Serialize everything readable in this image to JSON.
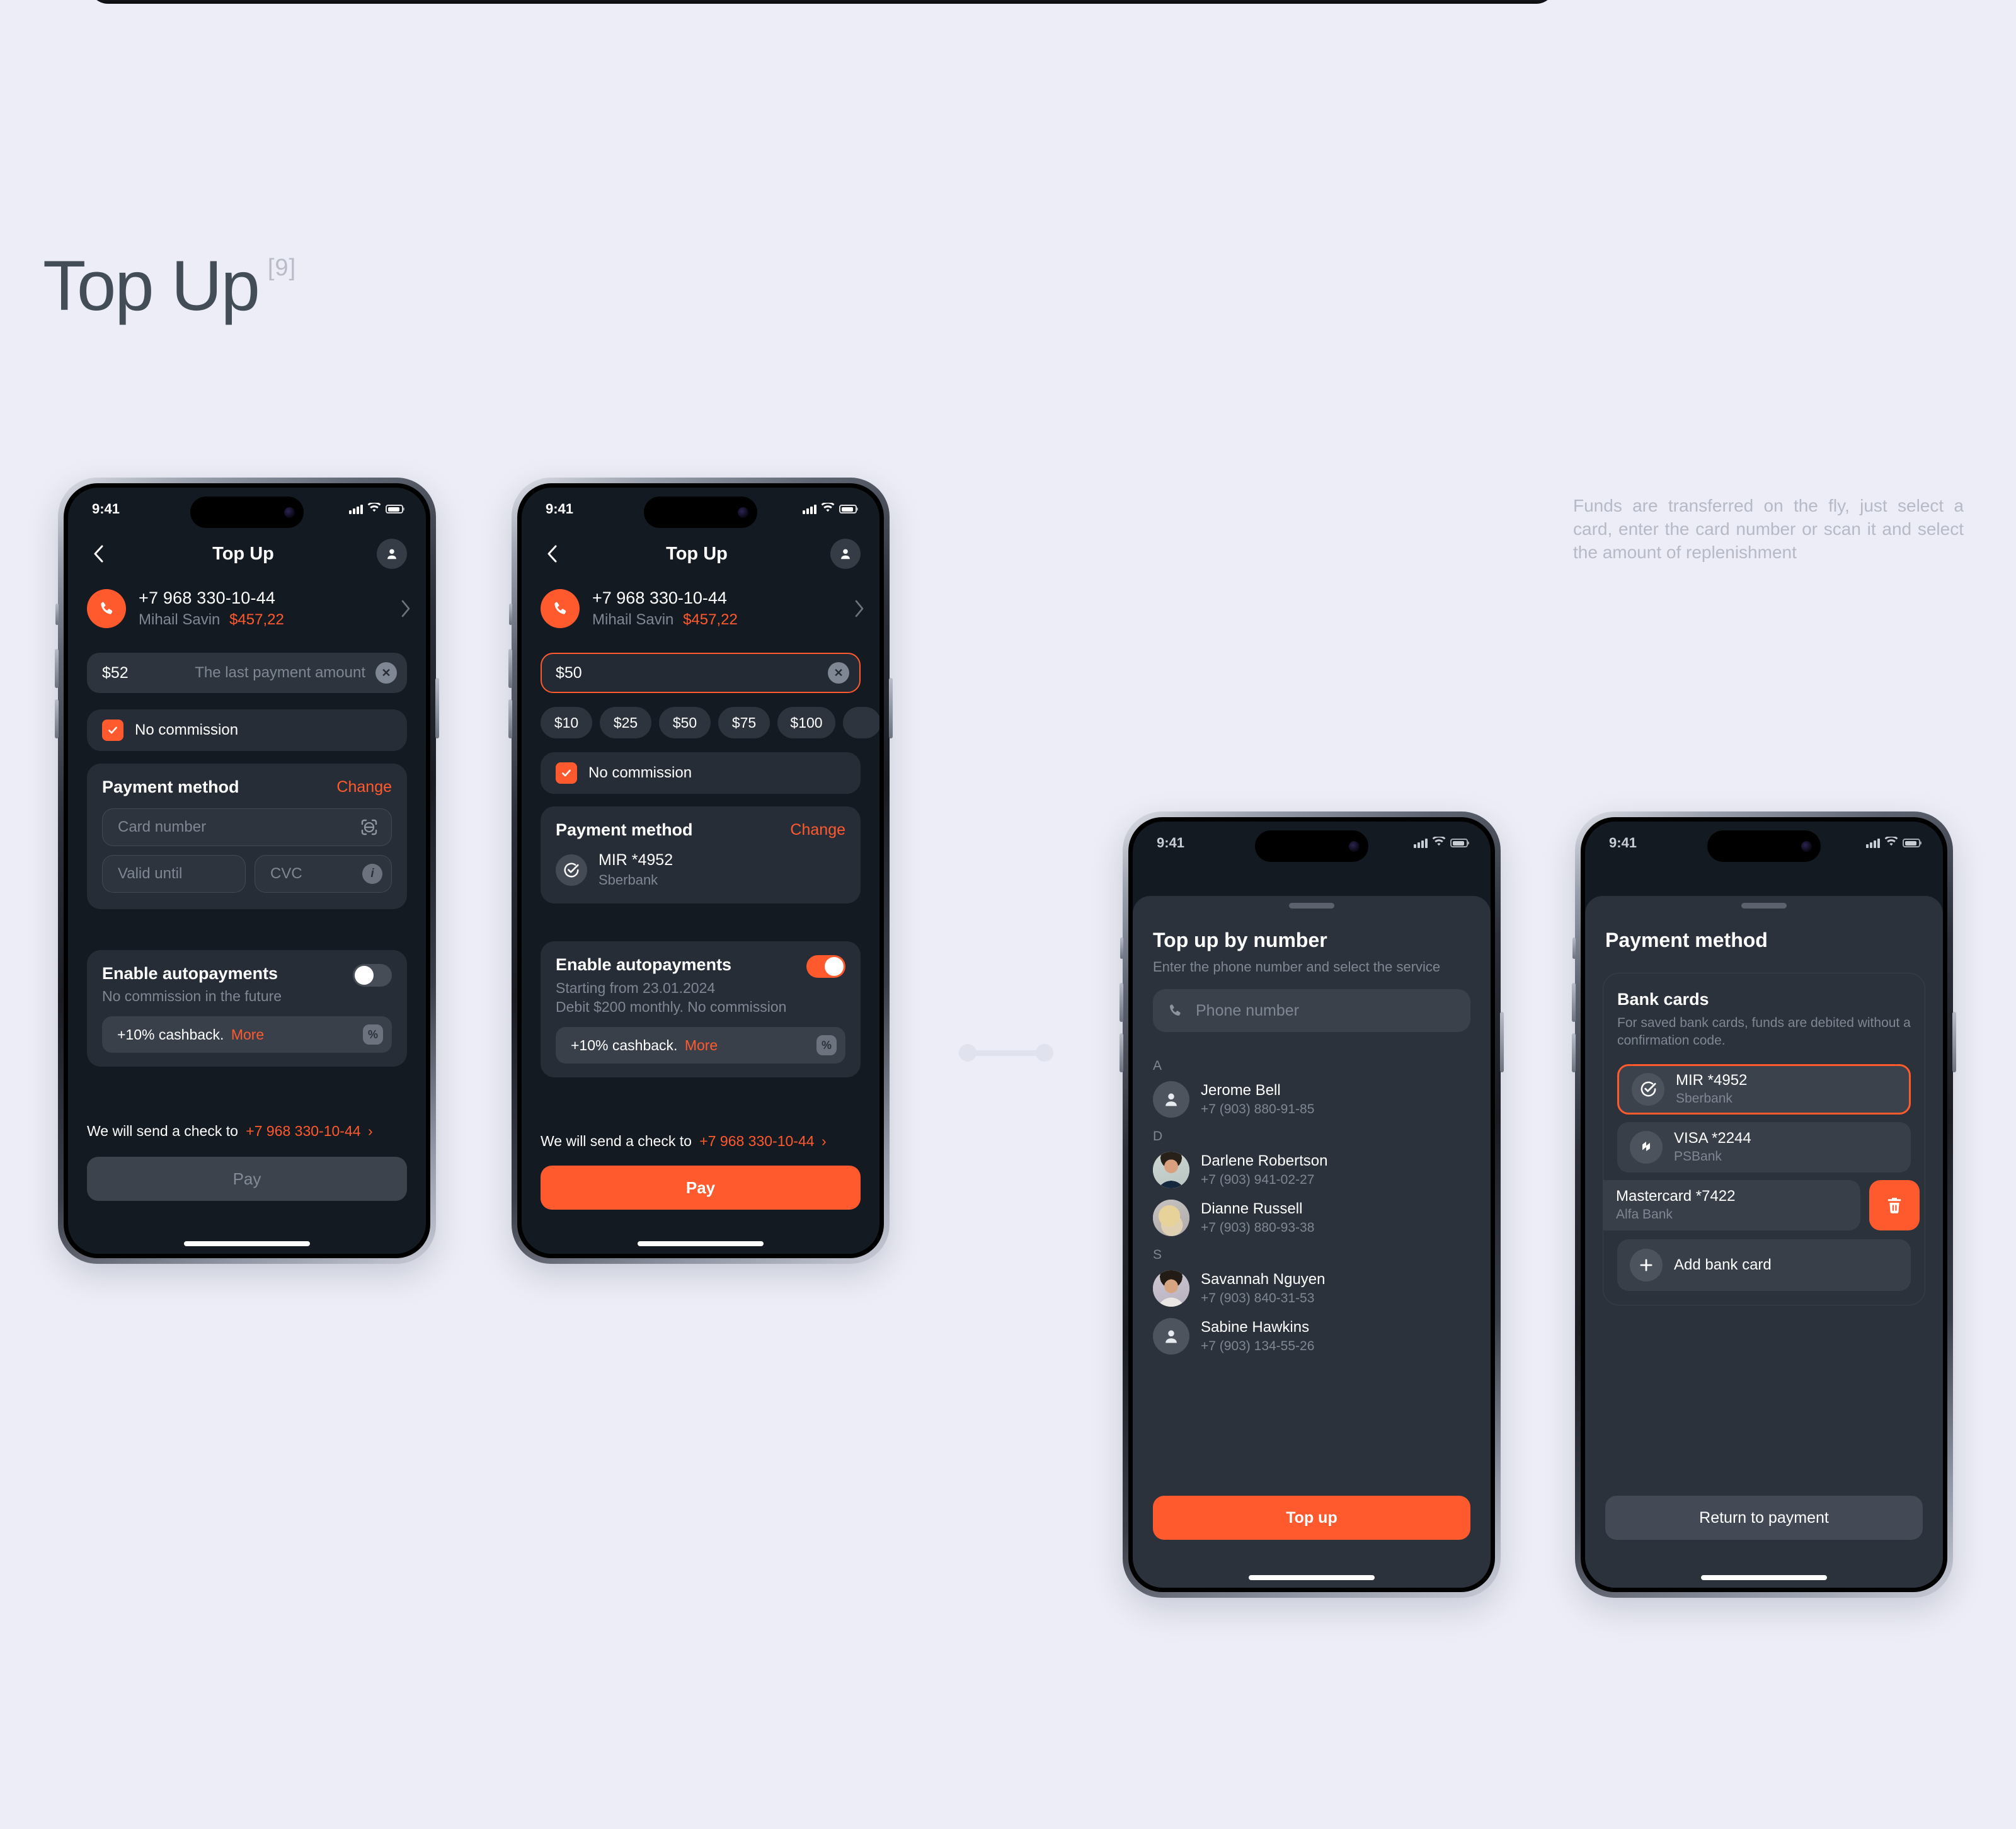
{
  "page": {
    "title": "Top Up",
    "badge": "[9]",
    "note": "Funds are transferred on the fly, just select a card, enter the card number or scan it and select the amount of replenishment"
  },
  "status_bar": {
    "time": "9:41"
  },
  "screen1": {
    "nav": {
      "back_icon": "chevron-left-icon",
      "title": "Top Up",
      "profile_icon": "person-icon"
    },
    "account": {
      "icon": "phone-icon",
      "phone": "+7 968 330-10-44",
      "name": "Mihail Savin",
      "balance": "$457,22",
      "chevron": "chevron-right-icon"
    },
    "amount_field": {
      "value": "$52",
      "hint": "The last payment amount",
      "clear_icon": "close-circle-icon"
    },
    "commission": {
      "label": "No commission",
      "checked": true
    },
    "payment_method": {
      "title": "Payment method",
      "change_label": "Change",
      "card_number_placeholder": "Card number",
      "scan_icon": "scan-card-icon",
      "valid_until_placeholder": "Valid until",
      "cvc_placeholder": "CVC",
      "info_icon": "info-icon"
    },
    "autopay": {
      "title": "Enable autopayments",
      "subtitle": "No commission in the future",
      "enabled": false,
      "cashback_text": "+10% cashback.",
      "cashback_link": "More",
      "percent_icon": "percent-icon"
    },
    "check_note": {
      "prefix": "We will send a check to",
      "phone": "+7 968 330-10-44",
      "chevron": "chevron-right-icon"
    },
    "pay_button": {
      "label": "Pay",
      "enabled": false
    }
  },
  "screen2": {
    "nav": {
      "back_icon": "chevron-left-icon",
      "title": "Top Up",
      "profile_icon": "person-icon"
    },
    "account": {
      "icon": "phone-icon",
      "phone": "+7 968 330-10-44",
      "name": "Mihail Savin",
      "balance": "$457,22",
      "chevron": "chevron-right-icon"
    },
    "amount_field": {
      "value": "$50",
      "clear_icon": "close-circle-icon",
      "focused": true
    },
    "quick_amounts": [
      "$10",
      "$25",
      "$50",
      "$75",
      "$100"
    ],
    "commission": {
      "label": "No commission",
      "checked": true
    },
    "payment_method": {
      "title": "Payment method",
      "change_label": "Change",
      "card_icon": "mir-check-icon",
      "card_name": "MIR *4952",
      "card_bank": "Sberbank"
    },
    "autopay": {
      "title": "Enable autopayments",
      "line1": "Starting from 23.01.2024",
      "line2": "Debit $200 monthly. No commission",
      "enabled": true,
      "cashback_text": "+10% cashback.",
      "cashback_link": "More",
      "percent_icon": "percent-icon"
    },
    "check_note": {
      "prefix": "We will send a check to",
      "phone": "+7 968 330-10-44",
      "chevron": "chevron-right-icon"
    },
    "pay_button": {
      "label": "Pay",
      "enabled": true
    }
  },
  "screen3": {
    "title": "Top up by number",
    "subtitle": "Enter the phone number and select the service",
    "search": {
      "icon": "phone-icon",
      "placeholder": "Phone number",
      "value": ""
    },
    "sections": [
      {
        "letter": "A",
        "contacts": [
          {
            "name": "Jerome Bell",
            "phone": "+7 (903) 880-91-85",
            "avatar": "person-placeholder"
          }
        ]
      },
      {
        "letter": "D",
        "contacts": [
          {
            "name": "Darlene Robertson",
            "phone": "+7 (903) 941-02-27",
            "avatar": "photo-dark-hair"
          },
          {
            "name": "Dianne Russell",
            "phone": "+7 (903) 880-93-38",
            "avatar": "photo-blonde"
          }
        ]
      },
      {
        "letter": "S",
        "contacts": [
          {
            "name": "Savannah Nguyen",
            "phone": "+7 (903) 840-31-53",
            "avatar": "photo-short-hair"
          },
          {
            "name": "Sabine Hawkins",
            "phone": "+7 (903) 134-55-26",
            "avatar": "person-placeholder"
          }
        ]
      }
    ],
    "cta": {
      "label": "Top up"
    }
  },
  "screen4": {
    "title": "Payment method",
    "group": {
      "title": "Bank cards",
      "subtitle": "For saved bank cards, funds are debited without a confirmation code."
    },
    "cards": [
      {
        "name": "MIR *4952",
        "bank": "Sberbank",
        "icon": "mir-check-icon",
        "selected": true,
        "deleting": false
      },
      {
        "name": "VISA *2244",
        "bank": "PSBank",
        "icon": "psbank-icon",
        "selected": false,
        "deleting": false
      },
      {
        "name": "Mastercard *7422",
        "bank": "Alfa Bank",
        "icon": "none",
        "selected": false,
        "deleting": true
      }
    ],
    "delete_icon": "trash-icon",
    "add_card": {
      "label": "Add bank card",
      "icon": "plus-icon"
    },
    "cta": {
      "label": "Return to payment"
    }
  },
  "colors": {
    "background": "#ecedf6",
    "accent": "#ff5a2e",
    "screen_bg": "#141a22",
    "card_bg": "#272d36",
    "sheet_bg": "#2b323b",
    "title": "#434d57"
  }
}
